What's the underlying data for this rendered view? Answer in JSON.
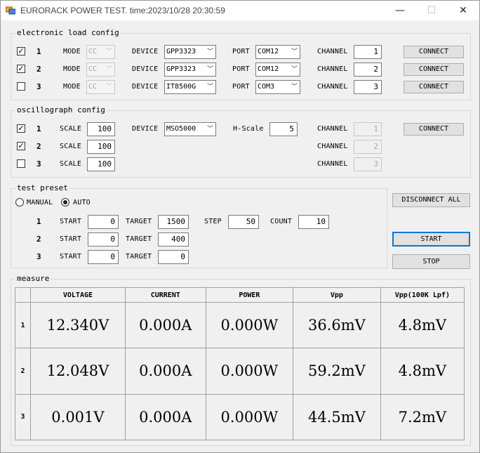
{
  "window": {
    "title": "EURORACK POWER TEST. time:2023/10/28 20:30:59",
    "minimize_glyph": "—",
    "maximize_glyph": "☐",
    "close_glyph": "✕",
    "icon": "app-icon"
  },
  "eload": {
    "title": "electronic load config",
    "mode_label": "MODE",
    "device_label": "DEVICE",
    "port_label": "PORT",
    "channel_label": "CHANNEL",
    "connect_label": "CONNECT",
    "rows": [
      {
        "index": "1",
        "checked": true,
        "mode": "CC",
        "device": "GPP3323",
        "port": "COM12",
        "channel": "1"
      },
      {
        "index": "2",
        "checked": true,
        "mode": "CC",
        "device": "GPP3323",
        "port": "COM12",
        "channel": "2"
      },
      {
        "index": "3",
        "checked": false,
        "mode": "CC",
        "device": "IT8500G",
        "port": "COM3",
        "channel": "3"
      }
    ]
  },
  "osc": {
    "title": "oscillograph config",
    "scale_label": "SCALE",
    "device_label": "DEVICE",
    "device": "MSO5000",
    "hscale_label": "H-Scale",
    "hscale": "5",
    "channel_label": "CHANNEL",
    "connect_label": "CONNECT",
    "rows": [
      {
        "index": "1",
        "checked": true,
        "scale": "100",
        "channel": "1"
      },
      {
        "index": "2",
        "checked": true,
        "scale": "100",
        "channel": "2"
      },
      {
        "index": "3",
        "checked": false,
        "scale": "100",
        "channel": "3"
      }
    ]
  },
  "preset": {
    "title": "test preset",
    "manual_label": "MANUAL",
    "auto_label": "AUTO",
    "selected": "AUTO",
    "start_label": "START",
    "target_label": "TARGET",
    "step_label": "STEP",
    "count_label": "COUNT",
    "step": "50",
    "count": "10",
    "rows": [
      {
        "index": "1",
        "start": "0",
        "target": "1500"
      },
      {
        "index": "2",
        "start": "0",
        "target": "400"
      },
      {
        "index": "3",
        "start": "0",
        "target": "0"
      }
    ]
  },
  "actions": {
    "disconnect_all": "DISCONNECT ALL",
    "start": "START",
    "stop": "STOP"
  },
  "measure": {
    "title": "measure",
    "headers": [
      "VOLTAGE",
      "CURRENT",
      "POWER",
      "Vpp",
      "Vpp(100K Lpf)"
    ],
    "rows": [
      {
        "index": "1",
        "values": [
          "12.340V",
          "0.000A",
          "0.000W",
          "36.6mV",
          "4.8mV"
        ]
      },
      {
        "index": "2",
        "values": [
          "12.048V",
          "0.000A",
          "0.000W",
          "59.2mV",
          "4.8mV"
        ]
      },
      {
        "index": "3",
        "values": [
          "0.001V",
          "0.000A",
          "0.000W",
          "44.5mV",
          "7.2mV"
        ]
      }
    ]
  },
  "colors": {
    "window_bg": "#f0f0f0",
    "focus_border": "#0078d7",
    "button_bg": "#e1e1e1"
  }
}
